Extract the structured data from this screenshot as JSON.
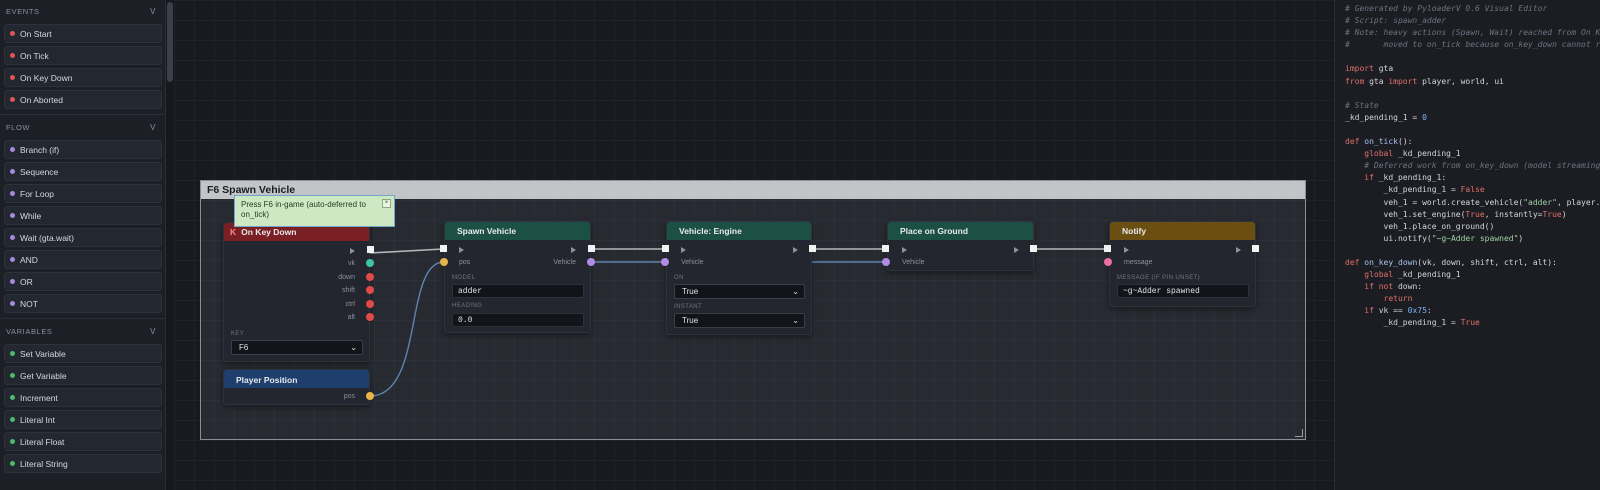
{
  "sidebar": {
    "sections": [
      {
        "title": "EVENTS",
        "items": [
          {
            "label": "On Start",
            "color": "#e05555"
          },
          {
            "label": "On Tick",
            "color": "#e05555"
          },
          {
            "label": "On Key Down",
            "color": "#e05555"
          },
          {
            "label": "On Aborted",
            "color": "#e05555"
          }
        ]
      },
      {
        "title": "FLOW",
        "items": [
          {
            "label": "Branch (if)",
            "color": "#a58be0"
          },
          {
            "label": "Sequence",
            "color": "#a58be0"
          },
          {
            "label": "For Loop",
            "color": "#a58be0"
          },
          {
            "label": "While",
            "color": "#a58be0"
          },
          {
            "label": "Wait (gta.wait)",
            "color": "#a58be0"
          },
          {
            "label": "AND",
            "color": "#a58be0"
          },
          {
            "label": "OR",
            "color": "#a58be0"
          },
          {
            "label": "NOT",
            "color": "#a58be0"
          }
        ]
      },
      {
        "title": "VARIABLES",
        "items": [
          {
            "label": "Set Variable",
            "color": "#4fb86a"
          },
          {
            "label": "Get Variable",
            "color": "#4fb86a"
          },
          {
            "label": "Increment",
            "color": "#4fb86a"
          },
          {
            "label": "Literal Int",
            "color": "#4fb86a"
          },
          {
            "label": "Literal Float",
            "color": "#4fb86a"
          },
          {
            "label": "Literal String",
            "color": "#4fb86a"
          }
        ]
      }
    ],
    "chevron": "v"
  },
  "canvas": {
    "group_title": "F6 Spawn Vehicle",
    "tooltip": {
      "text": "Press F6 in-game (auto-deferred to on_tick)",
      "close": "×"
    },
    "nodes": {
      "on_key_down": {
        "badge": "K",
        "title": "On Key Down",
        "ports": [
          "vk",
          "down",
          "shift",
          "ctrl",
          "alt"
        ],
        "key_label": "KEY",
        "key_value": "F6",
        "color": "#7a1f24"
      },
      "player_position": {
        "title": "Player Position",
        "port": "pos",
        "color": "#1e3f6e"
      },
      "spawn_vehicle": {
        "title": "Spawn Vehicle",
        "in_port": "pos",
        "out_port": "Vehicle",
        "model_label": "MODEL",
        "model_value": "adder",
        "heading_label": "HEADING",
        "heading_value": "0.0",
        "color": "#1d5045"
      },
      "vehicle_engine": {
        "title": "Vehicle: Engine",
        "in_port": "Vehicle",
        "on_label": "ON",
        "on_value": "True",
        "instant_label": "INSTANT",
        "instant_value": "True",
        "color": "#1d5045"
      },
      "place_on_ground": {
        "title": "Place on Ground",
        "in_port": "Vehicle",
        "color": "#1d5045"
      },
      "notify": {
        "title": "Notify",
        "in_port": "message",
        "msg_label": "MESSAGE (IF PIN UNSET)",
        "msg_value": "~g~Adder spawned",
        "color": "#6b4f12"
      }
    },
    "port_colors": {
      "exec": "#f2f2f2",
      "vk": "#3ec2a8",
      "bool": "#e04a4a",
      "vector": "#e8b44a",
      "vehicle": "#b08be8",
      "string": "#e870a0"
    }
  },
  "code": {
    "lines": [
      [
        [
          "cm",
          "# Generated by PyloaderV 0.6 Visual Editor"
        ]
      ],
      [
        [
          "cm",
          "# Script: spawn_adder"
        ]
      ],
      [
        [
          "cm",
          "# Note: heavy actions (Spawn, Wait) reached from On Ke"
        ]
      ],
      [
        [
          "cm",
          "#       moved to on_tick because on_key_down cannot ru"
        ]
      ],
      [],
      [
        [
          "kw",
          "import"
        ],
        [
          "tx",
          " gta"
        ]
      ],
      [
        [
          "kw",
          "from"
        ],
        [
          "tx",
          " gta "
        ],
        [
          "kw",
          "import"
        ],
        [
          "tx",
          " player, world, ui"
        ]
      ],
      [],
      [
        [
          "cm",
          "# State"
        ]
      ],
      [
        [
          "tx",
          "_kd_pending_1 = "
        ],
        [
          "nm",
          "0"
        ]
      ],
      [],
      [
        [
          "kw",
          "def"
        ],
        [
          "tx",
          " "
        ],
        [
          "fn",
          "on_tick"
        ],
        [
          "tx",
          "():"
        ]
      ],
      [
        [
          "tx",
          "    "
        ],
        [
          "kw",
          "global"
        ],
        [
          "tx",
          " _kd_pending_1"
        ]
      ],
      [
        [
          "tx",
          "    "
        ],
        [
          "cm",
          "# Deferred work from on_key_down (model streaming"
        ]
      ],
      [
        [
          "tx",
          "    "
        ],
        [
          "kw",
          "if"
        ],
        [
          "tx",
          " _kd_pending_1:"
        ]
      ],
      [
        [
          "tx",
          "        _kd_pending_1 = "
        ],
        [
          "kw",
          "False"
        ]
      ],
      [
        [
          "tx",
          "        veh_1 = world.create_vehicle("
        ],
        [
          "st",
          "\"adder\""
        ],
        [
          "tx",
          ", player.c"
        ]
      ],
      [
        [
          "tx",
          "        veh_1.set_engine("
        ],
        [
          "kw",
          "True"
        ],
        [
          "tx",
          ", instantly="
        ],
        [
          "kw",
          "True"
        ],
        [
          "tx",
          ")"
        ]
      ],
      [
        [
          "tx",
          "        veh_1.place_on_ground()"
        ]
      ],
      [
        [
          "tx",
          "        ui.notify("
        ],
        [
          "st",
          "\"~g~Adder spawned\""
        ],
        [
          "tx",
          ")"
        ]
      ],
      [],
      [
        [
          "kw",
          "def"
        ],
        [
          "tx",
          " "
        ],
        [
          "fn",
          "on_key_down"
        ],
        [
          "tx",
          "(vk, down, shift, ctrl, alt):"
        ]
      ],
      [
        [
          "tx",
          "    "
        ],
        [
          "kw",
          "global"
        ],
        [
          "tx",
          " _kd_pending_1"
        ]
      ],
      [
        [
          "tx",
          "    "
        ],
        [
          "kw",
          "if not"
        ],
        [
          "tx",
          " down:"
        ]
      ],
      [
        [
          "tx",
          "        "
        ],
        [
          "kw",
          "return"
        ]
      ],
      [
        [
          "tx",
          "    "
        ],
        [
          "kw",
          "if"
        ],
        [
          "tx",
          " vk == "
        ],
        [
          "nm",
          "0x75"
        ],
        [
          "tx",
          ":"
        ]
      ],
      [
        [
          "tx",
          "        _kd_pending_1 = "
        ],
        [
          "kw",
          "True"
        ]
      ]
    ]
  }
}
